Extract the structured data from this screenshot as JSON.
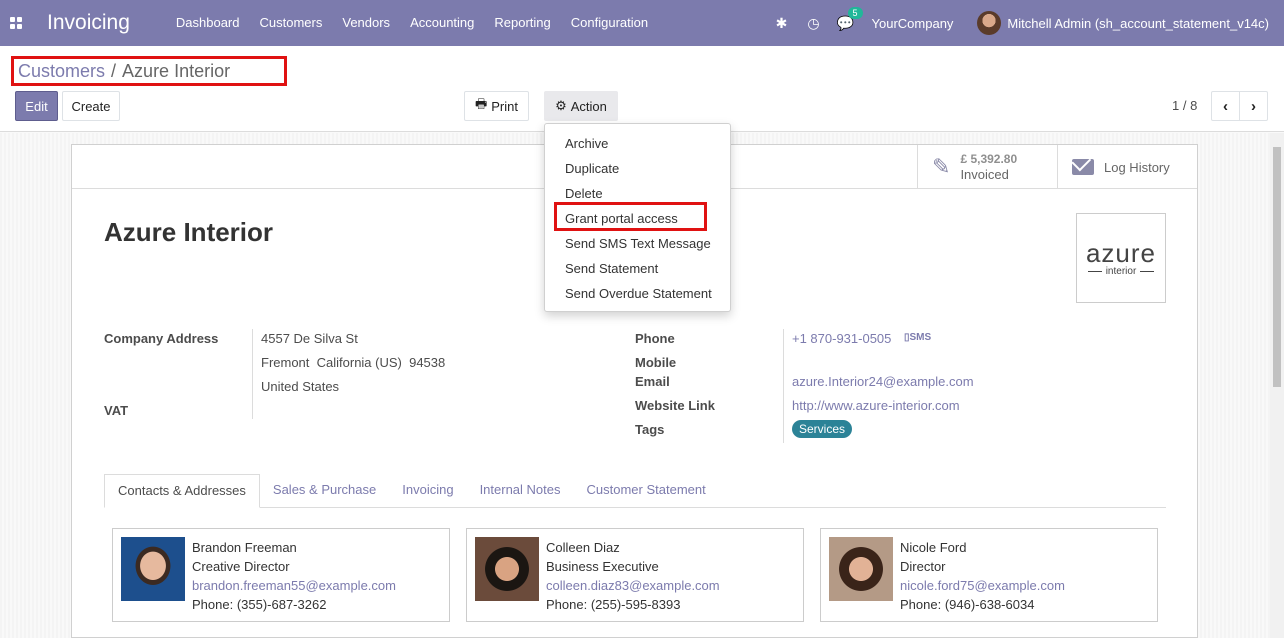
{
  "navbar": {
    "brand": "Invoicing",
    "menu": [
      "Dashboard",
      "Customers",
      "Vendors",
      "Accounting",
      "Reporting",
      "Configuration"
    ],
    "chat_badge": "5",
    "company": "YourCompany",
    "user": "Mitchell Admin (sh_account_statement_v14c)"
  },
  "breadcrumb": {
    "parent": "Customers",
    "sep": "/",
    "current": "Azure Interior"
  },
  "buttons": {
    "edit": "Edit",
    "create": "Create",
    "print": "Print",
    "action": "Action"
  },
  "pager": {
    "value": "1 / 8"
  },
  "action_menu": [
    "Archive",
    "Duplicate",
    "Delete",
    "Grant portal access",
    "Send SMS Text Message",
    "Send Statement",
    "Send Overdue Statement"
  ],
  "smart_buttons": {
    "invoiced_value": "£ 5,392.80",
    "invoiced_label": "Invoiced",
    "log_label": "Log History"
  },
  "partner": {
    "name": "Azure Interior",
    "logo_main": "azure",
    "logo_sub": "interior",
    "address_label": "Company Address",
    "street": "4557 De Silva St",
    "city_line": "Fremont  California (US)  94538",
    "country": "United States",
    "vat_label": "VAT",
    "phone_label": "Phone",
    "phone": "+1 870-931-0505",
    "sms": "SMS",
    "mobile_label": "Mobile",
    "email_label": "Email",
    "email": "azure.Interior24@example.com",
    "website_label": "Website Link",
    "website": "http://www.azure-interior.com",
    "tags_label": "Tags",
    "tag": "Services"
  },
  "tabs": [
    "Contacts & Addresses",
    "Sales & Purchase",
    "Invoicing",
    "Internal Notes",
    "Customer Statement"
  ],
  "contacts": [
    {
      "name": "Brandon Freeman",
      "title": "Creative Director",
      "email": "brandon.freeman55@example.com",
      "phone": "Phone: (355)-687-3262"
    },
    {
      "name": "Colleen Diaz",
      "title": "Business Executive",
      "email": "colleen.diaz83@example.com",
      "phone": "Phone: (255)-595-8393"
    },
    {
      "name": "Nicole Ford",
      "title": "Director",
      "email": "nicole.ford75@example.com",
      "phone": "Phone: (946)-638-6034"
    }
  ],
  "colors": {
    "brand": "#7c7bad",
    "highlight": "#e01212",
    "tag": "#2c8397"
  },
  "icons": [
    "apps-grid-icon",
    "bug-icon",
    "clock-icon",
    "chat-icon",
    "print-icon",
    "gear-icon",
    "edit-icon",
    "envelope-icon",
    "chevron-left-icon",
    "chevron-right-icon",
    "mobile-icon"
  ]
}
